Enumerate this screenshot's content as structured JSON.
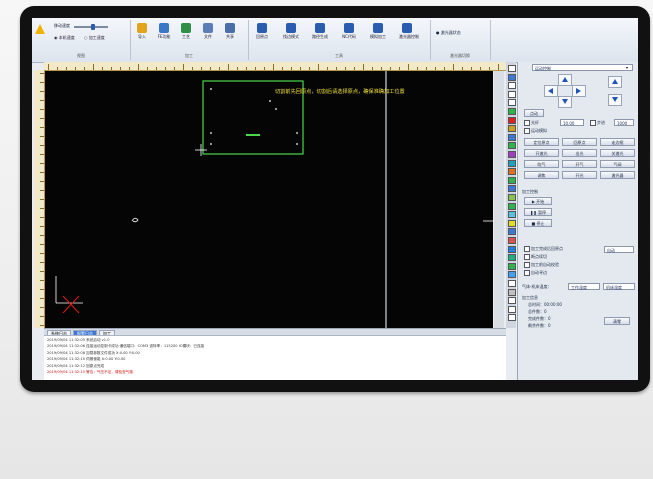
{
  "ribbon": {
    "groups": [
      {
        "name": "group-view",
        "caption": "视图"
      },
      {
        "name": "group-tools",
        "caption": "加工"
      },
      {
        "name": "group-draw",
        "caption": "工具"
      },
      {
        "name": "group-other",
        "caption": "激光器切换"
      }
    ],
    "speed_label": "移动速度",
    "speed_level": 0.55,
    "radio_fast": "本机速度",
    "radio_slow": "加工速度",
    "buttons_left": [
      {
        "name": "import-button",
        "label": "导入",
        "icon": "folder-icon",
        "color": "#e2a31d"
      },
      {
        "name": "feature-button",
        "label": "FE功能",
        "icon": "settings-icon",
        "color": "#3a77c4"
      },
      {
        "name": "craft-button",
        "label": "工艺",
        "icon": "layers-icon",
        "color": "#2f8f46"
      },
      {
        "name": "file-button",
        "label": "文件",
        "icon": "document-icon",
        "color": "#5a7fb8"
      },
      {
        "name": "share-button",
        "label": "共享",
        "icon": "share-icon",
        "color": "#4a6fa8"
      }
    ],
    "buttons_right": [
      {
        "name": "return-origin-button",
        "label": "回原点",
        "icon": "undo-arrow-icon",
        "color": "#2a5db0"
      },
      {
        "name": "find-edge-button",
        "label": "找边模式",
        "icon": "crosshair-icon",
        "color": "#2a5db0"
      },
      {
        "name": "path-button",
        "label": "路径生成",
        "icon": "path-icon",
        "color": "#2a5db0"
      },
      {
        "name": "nc-button",
        "label": "NC代码",
        "icon": "monitor-icon",
        "color": "#2a5db0"
      },
      {
        "name": "sim-button",
        "label": "模拟加工",
        "icon": "globe-icon",
        "color": "#2a5db0"
      },
      {
        "name": "laser-button",
        "label": "激光器控制",
        "icon": "binoculars-icon",
        "color": "#2a5db0"
      }
    ],
    "status_label": "● 激光器状态"
  },
  "canvas": {
    "overlay_text": "切割前先回原点，切割后请选择原点，确保准确加工位置",
    "overlay_color": "#f2e23a",
    "shape_color": "#4ad94a",
    "axis_color": "#ffffff",
    "origin_color": "#e01818"
  },
  "panel": {
    "mode_combo": "运动控制",
    "section_motion": "运动控制",
    "jog_label": "点动",
    "step_label": "步进",
    "step_value": "10.00",
    "speed_value": "1000",
    "check_1": "光纤",
    "check_2": "运动模拟",
    "btn_row1": [
      "定位原点",
      "回原点",
      "走边框"
    ],
    "btn_row2": [
      "开激光",
      "出光",
      "关激光"
    ],
    "btn_row3": [
      "吹气",
      "开气",
      "气阀"
    ],
    "btn_row4": [
      "调焦",
      "开光",
      "激光器"
    ],
    "section_process": "加工控制",
    "start_label": "开始",
    "pause_label": "暂停",
    "stop_label": "停止",
    "options": [
      "加工完成后回原点",
      "断点续切",
      "加工前自动校验",
      "自动寻边"
    ],
    "mode_select": "自动",
    "gas_label": "气体-机床温度：",
    "gas_values": [
      "工作温度",
      "机床温度"
    ],
    "section_info": "加工信息",
    "info_lines": [
      "总时间：00:00:00",
      "总件数：0",
      "完成件数：0",
      "剩余件数：0"
    ],
    "reset_button": "清零"
  },
  "log": {
    "tabs": [
      "系统日志",
      "报警日志",
      "加工"
    ],
    "lines": [
      {
        "text": "2019/09/04 11:32:05 系统启动  v1.0",
        "warn": false
      },
      {
        "text": "2019/09/04 11:32:06 连接运动控制卡成功  通信端口：COM3  波特率：115200  IO模块：已连接",
        "warn": false
      },
      {
        "text": "2019/09/04 11:32:08 加载参数文件成功  X:0.00 Y:0.00",
        "warn": false
      },
      {
        "text": "2019/09/04 11:32:10 伺服使能  X:0.00 Y:0.00",
        "warn": false
      },
      {
        "text": "2019/09/04 11:32:12 回原点完成",
        "warn": false
      },
      {
        "text": "2019/09/04 11:32:15 警告：气压不足，请检查气路",
        "warn": true
      }
    ]
  }
}
